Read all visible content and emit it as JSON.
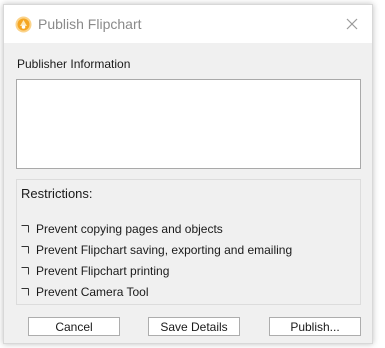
{
  "window": {
    "title": "Publish Flipchart",
    "app_icon": "flipchart-icon",
    "close_icon": "close-icon"
  },
  "publisher": {
    "label": "Publisher Information",
    "value": ""
  },
  "restrictions": {
    "title": "Restrictions:",
    "options": [
      {
        "label": "Prevent copying pages and objects",
        "checked": false
      },
      {
        "label": "Prevent Flipchart saving, exporting and emailing",
        "checked": false
      },
      {
        "label": "Prevent Flipchart printing",
        "checked": false
      },
      {
        "label": "Prevent Camera Tool",
        "checked": false
      }
    ]
  },
  "buttons": {
    "cancel": "Cancel",
    "save_details": "Save Details",
    "publish": "Publish..."
  },
  "colors": {
    "dialog_bg": "#f0f0f0",
    "titlebar_bg": "#ffffff",
    "icon_orange": "#f5a623"
  }
}
